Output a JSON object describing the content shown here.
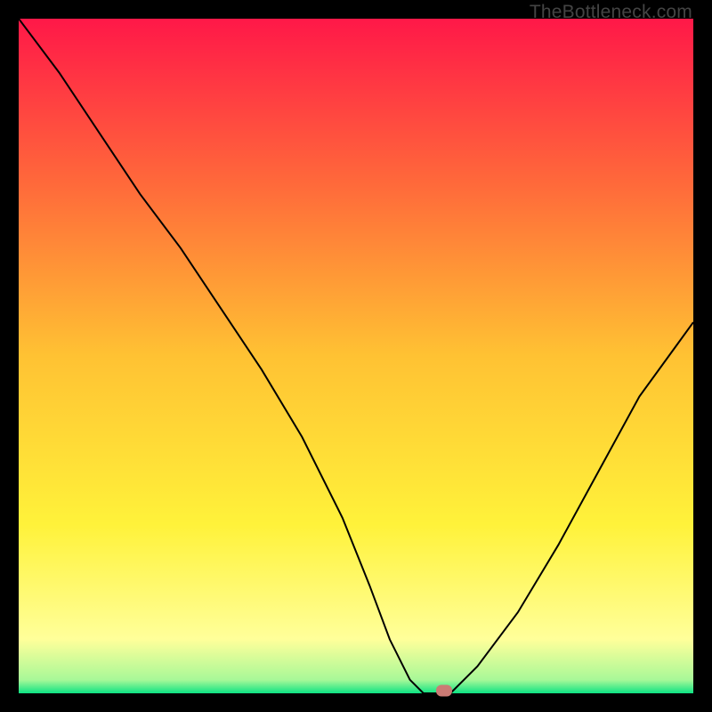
{
  "watermark": "TheBottleneck.com",
  "chart_data": {
    "type": "line",
    "title": "",
    "xlabel": "",
    "ylabel": "",
    "xlim": [
      0,
      100
    ],
    "ylim": [
      0,
      100
    ],
    "gradient_bands": [
      {
        "y": 100,
        "color": "#ff1848"
      },
      {
        "y": 75,
        "color": "#ff6b3a"
      },
      {
        "y": 50,
        "color": "#ffc233"
      },
      {
        "y": 25,
        "color": "#fff23a"
      },
      {
        "y": 8,
        "color": "#ffff9a"
      },
      {
        "y": 2,
        "color": "#a8f898"
      },
      {
        "y": 0,
        "color": "#0de383"
      }
    ],
    "series": [
      {
        "name": "curve",
        "x": [
          0,
          6,
          12,
          18,
          24,
          30,
          36,
          42,
          48,
          52,
          55,
          58,
          60,
          62,
          64,
          68,
          74,
          80,
          86,
          92,
          100
        ],
        "y": [
          100,
          92,
          83,
          74,
          66,
          57,
          48,
          38,
          26,
          16,
          8,
          2,
          0,
          0,
          0,
          4,
          12,
          22,
          33,
          44,
          55
        ]
      }
    ],
    "marker": {
      "x": 63,
      "y": 0,
      "color": "#cb7a74"
    }
  }
}
